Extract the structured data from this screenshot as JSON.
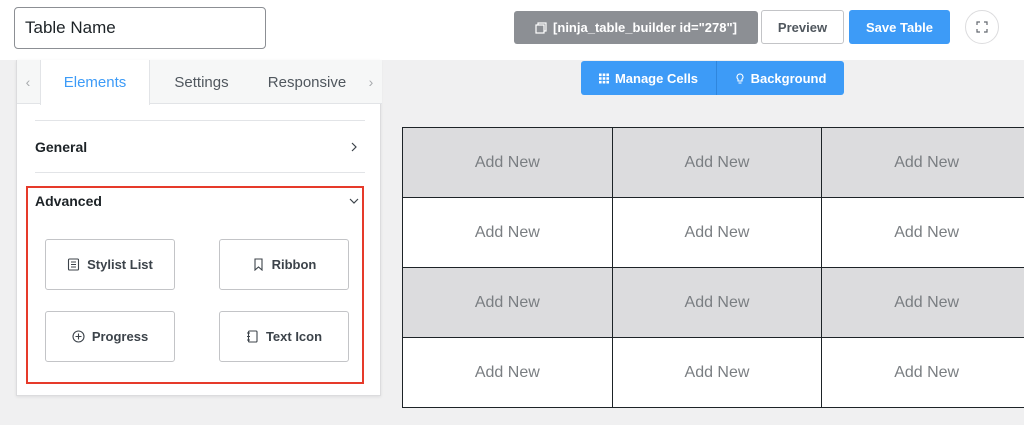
{
  "header": {
    "table_name": "Table Name",
    "shortcode": "[ninja_table_builder id=\"278\"]",
    "preview_label": "Preview",
    "save_label": "Save Table"
  },
  "panel": {
    "tabs": [
      {
        "label": "Elements",
        "active": true
      },
      {
        "label": "Settings",
        "active": false
      },
      {
        "label": "Responsive",
        "active": false
      }
    ],
    "sections": {
      "general": "General",
      "advanced": "Advanced"
    },
    "elements": [
      {
        "label": "Stylist List",
        "icon": "list-doc-icon"
      },
      {
        "label": "Ribbon",
        "icon": "bookmark-icon"
      },
      {
        "label": "Progress",
        "icon": "plus-circle-icon"
      },
      {
        "label": "Text Icon",
        "icon": "notebook-icon"
      }
    ]
  },
  "cell_toolbar": {
    "manage_cells": "Manage Cells",
    "background": "Background"
  },
  "grid": {
    "rows": [
      [
        "Add New",
        "Add New",
        "Add New"
      ],
      [
        "Add New",
        "Add New",
        "Add New"
      ],
      [
        "Add New",
        "Add New",
        "Add New"
      ],
      [
        "Add New",
        "Add New",
        "Add New"
      ]
    ]
  },
  "colors": {
    "accent": "#3d9bf7",
    "highlight_border": "#e63a2a",
    "shaded_row": "#dcdcde"
  }
}
